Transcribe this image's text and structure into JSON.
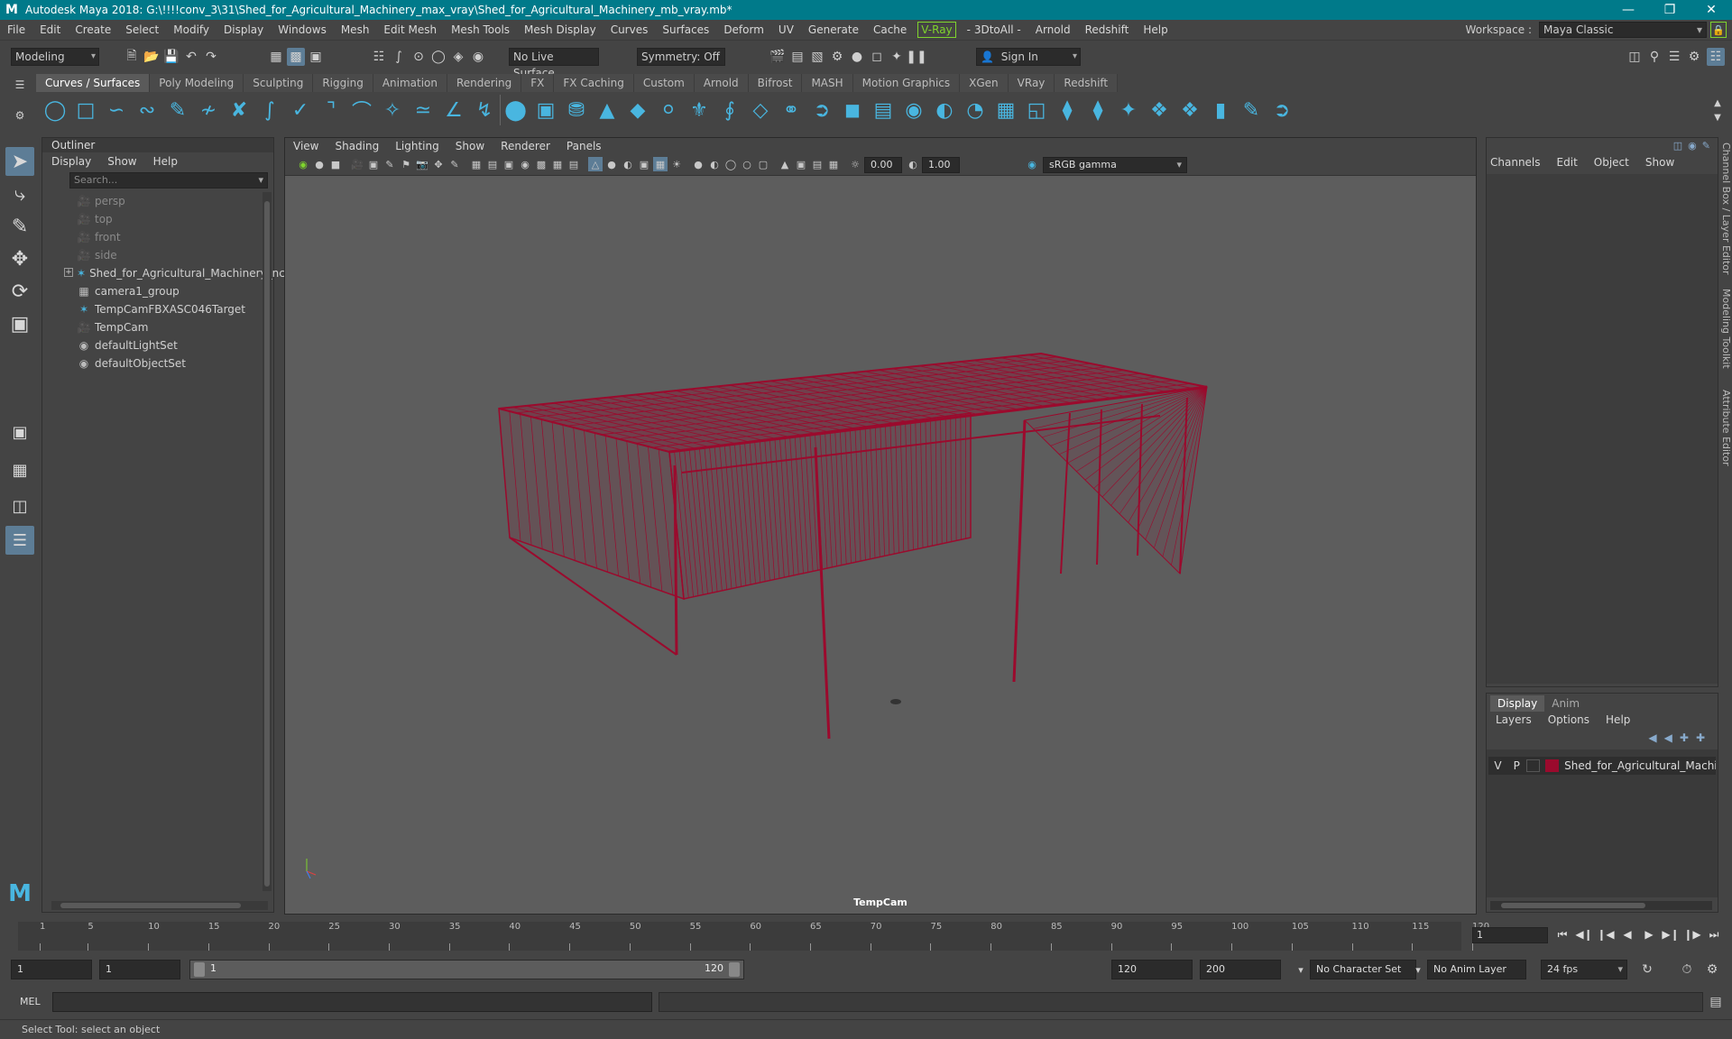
{
  "window": {
    "title": "Autodesk Maya 2018: G:\\!!!!conv_3\\31\\Shed_for_Agricultural_Machinery_max_vray\\Shed_for_Agricultural_Machinery_mb_vray.mb*",
    "logo": "M"
  },
  "menubar": {
    "items": [
      "File",
      "Edit",
      "Create",
      "Select",
      "Modify",
      "Display",
      "Windows",
      "Mesh",
      "Edit Mesh",
      "Mesh Tools",
      "Mesh Display",
      "Curves",
      "Surfaces",
      "Deform",
      "UV",
      "Generate",
      "Cache"
    ],
    "vray": "V-Ray",
    "items2": [
      "- 3DtoAll -",
      "Arnold",
      "Redshift",
      "Help"
    ],
    "workspace_label": "Workspace :",
    "workspace_value": "Maya Classic"
  },
  "statusline": {
    "menuset": "Modeling",
    "live_surface": "No Live Surface",
    "symmetry": "Symmetry: Off",
    "sign_in": "Sign In"
  },
  "shelf": {
    "tabs": [
      "Curves / Surfaces",
      "Poly Modeling",
      "Sculpting",
      "Rigging",
      "Animation",
      "Rendering",
      "FX",
      "FX Caching",
      "Custom",
      "Arnold",
      "Bifrost",
      "MASH",
      "Motion Graphics",
      "XGen",
      "VRay",
      "Redshift"
    ],
    "active_tab": "Curves / Surfaces"
  },
  "outliner": {
    "title": "Outliner",
    "menu": [
      "Display",
      "Show",
      "Help"
    ],
    "search_placeholder": "Search...",
    "items": [
      {
        "label": "persp",
        "icon": "camera-icon",
        "dim": true
      },
      {
        "label": "top",
        "icon": "camera-icon",
        "dim": true
      },
      {
        "label": "front",
        "icon": "camera-icon",
        "dim": true
      },
      {
        "label": "side",
        "icon": "camera-icon",
        "dim": true
      },
      {
        "label": "Shed_for_Agricultural_Machinery_ncl",
        "icon": "group-icon",
        "expand": true
      },
      {
        "label": "camera1_group",
        "icon": "transform-icon"
      },
      {
        "label": "TempCamFBXASC046Target",
        "icon": "group-icon"
      },
      {
        "label": "TempCam",
        "icon": "camera-icon"
      },
      {
        "label": "defaultLightSet",
        "icon": "set-icon"
      },
      {
        "label": "defaultObjectSet",
        "icon": "set-icon"
      }
    ]
  },
  "viewport": {
    "menu": [
      "View",
      "Shading",
      "Lighting",
      "Show",
      "Renderer",
      "Panels"
    ],
    "exposure": "0.00",
    "gamma": "1.00",
    "color_space": "sRGB gamma",
    "camera": "TempCam",
    "wire_color": "#9b0a2d"
  },
  "channelbox": {
    "menu": [
      "Channels",
      "Edit",
      "Object",
      "Show"
    ],
    "side_tabs": [
      "Channel Box / Layer Editor",
      "Modeling Toolkit",
      "Attribute Editor"
    ]
  },
  "layereditor": {
    "tabs": [
      "Display",
      "Anim"
    ],
    "active_tab": "Display",
    "menu": [
      "Layers",
      "Options",
      "Help"
    ],
    "layer": {
      "v": "V",
      "p": "P",
      "name": "Shed_for_Agricultural_Machin",
      "color": "#9b0a2d"
    }
  },
  "timeslider": {
    "ticks": [
      "1",
      "5",
      "10",
      "15",
      "20",
      "25",
      "30",
      "35",
      "40",
      "45",
      "50",
      "55",
      "60",
      "65",
      "70",
      "75",
      "80",
      "85",
      "90",
      "95",
      "100",
      "105",
      "110",
      "115",
      "120"
    ],
    "current_frame": "1"
  },
  "rangeslider": {
    "start": "1",
    "playback_start": "1",
    "range_start": "1",
    "range_end": "120",
    "playback_end": "120",
    "end": "200",
    "character_set": "No Character Set",
    "anim_layer": "No Anim Layer",
    "fps": "24 fps"
  },
  "cmdline": {
    "label": "MEL"
  },
  "helpline": {
    "text": "Select Tool: select an object"
  }
}
